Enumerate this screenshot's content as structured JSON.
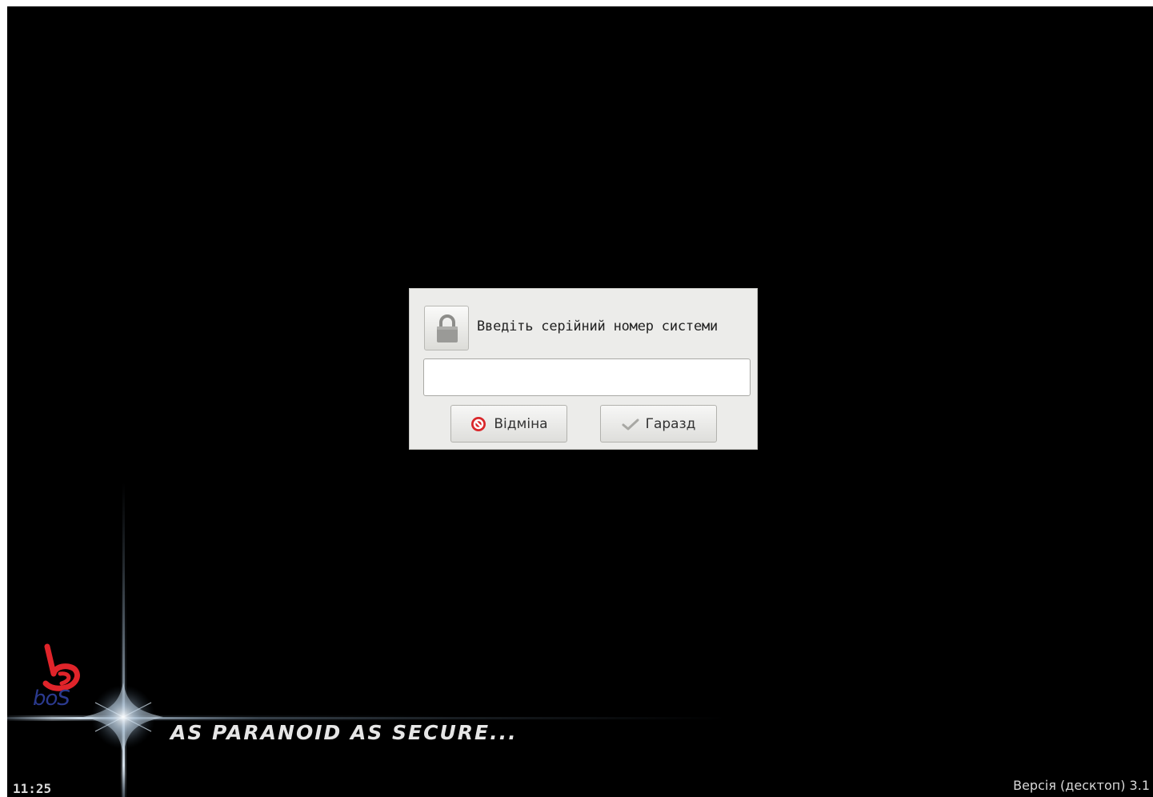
{
  "dialog": {
    "prompt": "Введіть серійний номер системи",
    "serial_value": "",
    "serial_placeholder": "",
    "cancel_label": "Відміна",
    "ok_label": "Гаразд"
  },
  "desktop": {
    "slogan": "AS PARANOID AS SECURE...",
    "clock": "11:25",
    "version": "Версія (десктоп) 3.1",
    "logo_text": "boS"
  },
  "icons": {
    "lock": "lock-icon",
    "cancel": "no-entry-icon",
    "ok": "checkmark-icon"
  },
  "colors": {
    "background": "#000000",
    "dialog_bg": "#ececea",
    "cancel_icon": "#d9262a",
    "logo_red": "#e0242a",
    "logo_blue": "#2b3a8f"
  }
}
